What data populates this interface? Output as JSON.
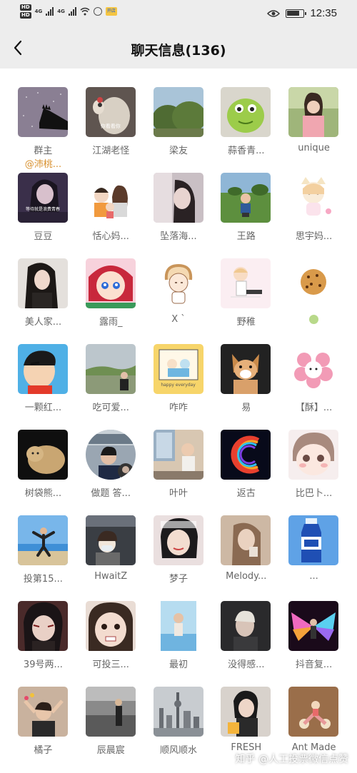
{
  "status_bar": {
    "sim1": "HD",
    "sim2": "HD",
    "net1": "4G",
    "net2": "4G",
    "app_badge": "开店",
    "time": "12:35",
    "battery_level": 0.8
  },
  "navbar": {
    "title": "聊天信息(136)"
  },
  "members": [
    {
      "name": "群主",
      "sub": "@沛桃..."
    },
    {
      "name": "江湖老怪",
      "avatar_caption": "你看看你"
    },
    {
      "name": "梁友"
    },
    {
      "name": "蒜香青..."
    },
    {
      "name": "unique"
    },
    {
      "name": "豆豆",
      "avatar_caption": "等待就是浪费青春"
    },
    {
      "name": "恬心妈..."
    },
    {
      "name": "坠落海..."
    },
    {
      "name": "王路"
    },
    {
      "name": "思宇妈..."
    },
    {
      "name": "美人家..."
    },
    {
      "name": "露雨_"
    },
    {
      "name": "X `"
    },
    {
      "name": "野稚"
    },
    {
      "name": ""
    },
    {
      "name": "一颗红..."
    },
    {
      "name": "吃可爱..."
    },
    {
      "name": "咋咋",
      "avatar_caption": "happy everyday"
    },
    {
      "name": "易"
    },
    {
      "name": "【酥】..."
    },
    {
      "name": "树袋熊..."
    },
    {
      "name": "做题 答..."
    },
    {
      "name": "叶叶"
    },
    {
      "name": "返古"
    },
    {
      "name": "比巴卜..."
    },
    {
      "name": "投第15..."
    },
    {
      "name": "HwaitZ"
    },
    {
      "name": "梦子"
    },
    {
      "name": "Melody..."
    },
    {
      "name": "..."
    },
    {
      "name": "39号两..."
    },
    {
      "name": "可投三..."
    },
    {
      "name": "最初"
    },
    {
      "name": "没得感..."
    },
    {
      "name": "抖音复..."
    },
    {
      "name": "橘子"
    },
    {
      "name": "辰晨宸"
    },
    {
      "name": "顺风顺水"
    },
    {
      "name": "FRESH"
    },
    {
      "name": "Ant Made"
    }
  ],
  "watermark": "知乎 @人工投票微信点赞"
}
